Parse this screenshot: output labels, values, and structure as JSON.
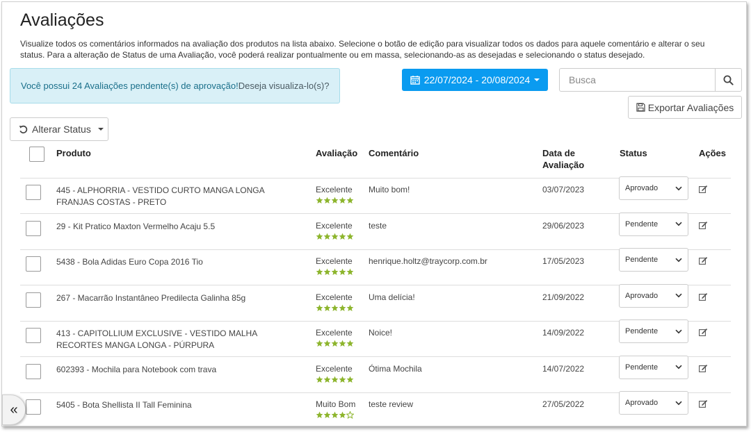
{
  "page": {
    "title": "Avaliações",
    "description": "Visualize todos os comentários informados na avaliação dos produtos na lista abaixo. Selecione o botão de edição para visualizar todos os dados para aquele comentário e alterar o seu status. Para a alteração de Status de uma Avaliação, você poderá realizar pontualmente ou em massa, selecionando-as as desejadas e selecionando o status desejado."
  },
  "alert": {
    "strong_text": "Você possui 24 Avaliações pendente(s) de aprovação!",
    "link_text": "Deseja visualiza-lo(s)?"
  },
  "date_range": {
    "label": "22/07/2024 - 20/08/2024"
  },
  "search": {
    "placeholder": "Busca"
  },
  "export": {
    "label": "Exportar Avaliações"
  },
  "bulk_status": {
    "label": "Alterar Status"
  },
  "table": {
    "columns": {
      "product": "Produto",
      "rating": "Avaliação",
      "comment": "Comentário",
      "date_line1": "Data de",
      "date_line2": "Avaliação",
      "status": "Status",
      "actions": "Ações"
    },
    "rows": [
      {
        "product": "445 - ALPHORRIA - VESTIDO CURTO MANGA LONGA FRANJAS COSTAS - PRETO",
        "rating_label": "Excelente",
        "stars": 5,
        "comment": "Muito bom!",
        "date": "03/07/2023",
        "status": "Aprovado"
      },
      {
        "product": "29 - Kit Pratico Maxton Vermelho Acaju 5.5",
        "rating_label": "Excelente",
        "stars": 5,
        "comment": "teste",
        "date": "29/06/2023",
        "status": "Pendente"
      },
      {
        "product": "5438 - Bola Adidas Euro Copa 2016 Tio",
        "rating_label": "Excelente",
        "stars": 5,
        "comment": "henrique.holtz@traycorp.com.br",
        "date": "17/05/2023",
        "status": "Pendente"
      },
      {
        "product": "267 - Macarrão Instantâneo Predilecta Galinha 85g",
        "rating_label": "Excelente",
        "stars": 5,
        "comment": "Uma delícia!",
        "date": "21/09/2022",
        "status": "Aprovado"
      },
      {
        "product": "413 - CAPITOLLIUM EXCLUSIVE - VESTIDO MALHA RECORTES MANGA LONGA - PÚRPURA",
        "rating_label": "Excelente",
        "stars": 5,
        "comment": "Noice!",
        "date": "14/09/2022",
        "status": "Pendente"
      },
      {
        "product": "602393 - Mochila para Notebook com trava",
        "rating_label": "Excelente",
        "stars": 5,
        "comment": "Ótima Mochila",
        "date": "14/07/2022",
        "status": "Pendente"
      },
      {
        "product": "5405 - Bota Shellista II Tall Feminina",
        "rating_label": "Muito Bom",
        "stars": 4,
        "comment": "teste review",
        "date": "27/05/2022",
        "status": "Aprovado"
      }
    ]
  },
  "collapse": {
    "label": "«"
  },
  "colors": {
    "accent": "#0a9bf0",
    "star": "#8db52d",
    "alert_bg": "#d9f0f7"
  }
}
